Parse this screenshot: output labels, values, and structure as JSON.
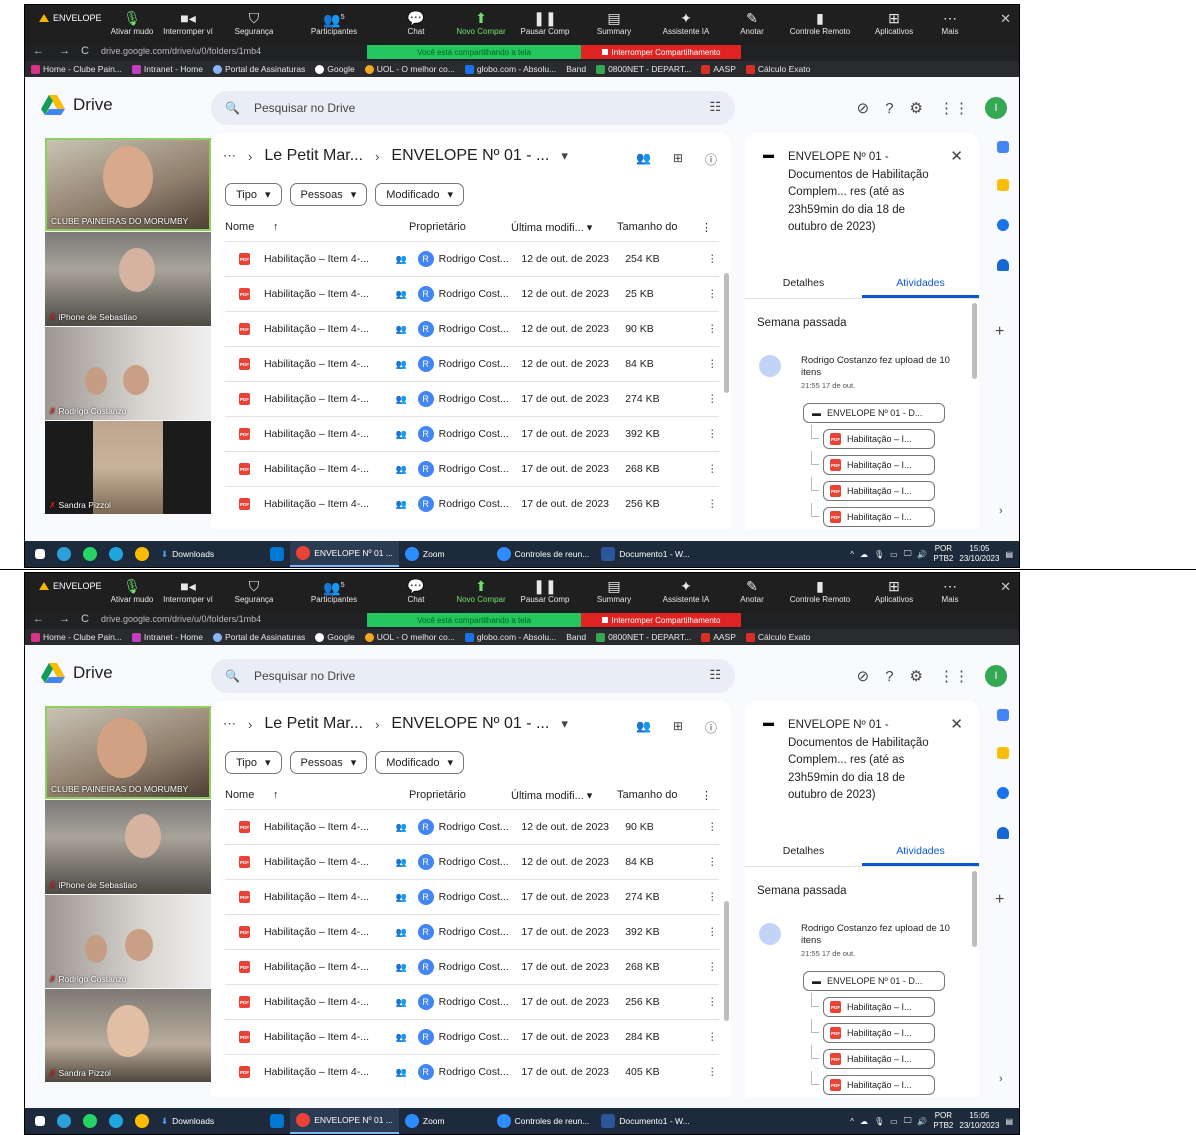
{
  "frames": [
    {
      "zoom": {
        "title": "ENVELOPE",
        "items": [
          {
            "label": "Ativar mudo",
            "icon": "microphone-icon"
          },
          {
            "label": "Interromper ví",
            "icon": "video-camera-icon"
          },
          {
            "label": "Segurança",
            "icon": "shield-icon"
          },
          {
            "label": "Participantes",
            "icon": "participants-icon",
            "count": "5"
          },
          {
            "label": "Chat",
            "icon": "chat-icon"
          },
          {
            "label": "Novo Compar",
            "icon": "share-screen-icon"
          },
          {
            "label": "Pausar Comp",
            "icon": "pause-icon"
          },
          {
            "label": "Summary",
            "icon": "summary-icon"
          },
          {
            "label": "Assistente IA",
            "icon": "sparkle-icon"
          },
          {
            "label": "Anotar",
            "icon": "pen-icon"
          },
          {
            "label": "Controle Remoto",
            "icon": "mouse-icon"
          },
          {
            "label": "Aplicativos",
            "icon": "apps-icon"
          },
          {
            "label": "Mais",
            "icon": "more-icon"
          }
        ],
        "sharing_banner": "Você está compartilhando a tela",
        "stop_sharing": "Interromper Compartilhamento"
      },
      "url": "drive.google.com/drive/u/0/folders/1mb4",
      "bookmarks": [
        "Home - Clube Pain...",
        "Intranet - Home",
        "Portal de Assinaturas",
        "Google",
        "UOL - O melhor co...",
        "globo.com - Absolu...",
        "Band",
        "0800NET - DEPART...",
        "AASP",
        "Cálculo Exato"
      ],
      "drive": {
        "app_name": "Drive",
        "search_placeholder": "Pesquisar no Drive",
        "avatar_letter": "I",
        "breadcrumb_parent": "Le Petit Mar...",
        "breadcrumb_current": "ENVELOPE Nº 01 - ...",
        "filters": [
          "Tipo",
          "Pessoas",
          "Modificado"
        ],
        "columns": {
          "name": "Nome",
          "owner": "Proprietário",
          "modified": "Última modifi...",
          "size": "Tamanho do"
        },
        "files": [
          {
            "name": "Habilitação – Item 4-...",
            "owner": "Rodrigo Cost...",
            "modified": "12 de out. de 2023",
            "size": "254 KB"
          },
          {
            "name": "Habilitação – Item 4-...",
            "owner": "Rodrigo Cost...",
            "modified": "12 de out. de 2023",
            "size": "25 KB"
          },
          {
            "name": "Habilitação – Item 4-...",
            "owner": "Rodrigo Cost...",
            "modified": "12 de out. de 2023",
            "size": "90 KB"
          },
          {
            "name": "Habilitação – Item 4-...",
            "owner": "Rodrigo Cost...",
            "modified": "12 de out. de 2023",
            "size": "84 KB"
          },
          {
            "name": "Habilitação – Item 4-...",
            "owner": "Rodrigo Cost...",
            "modified": "17 de out. de 2023",
            "size": "274 KB"
          },
          {
            "name": "Habilitação – Item 4-...",
            "owner": "Rodrigo Cost...",
            "modified": "17 de out. de 2023",
            "size": "392 KB"
          },
          {
            "name": "Habilitação – Item 4-...",
            "owner": "Rodrigo Cost...",
            "modified": "17 de out. de 2023",
            "size": "268 KB"
          },
          {
            "name": "Habilitação – Item 4-...",
            "owner": "Rodrigo Cost...",
            "modified": "17 de out. de 2023",
            "size": "256 KB"
          }
        ],
        "details": {
          "title": "ENVELOPE Nº 01 - Documentos de Habilitação Complem... res (até as 23h59min do dia 18 de outubro de 2023)",
          "tab_details": "Detalhes",
          "tab_activity": "Atividades",
          "week": "Semana passada",
          "activity_text": "Rodrigo Costanzo fez upload de 10 itens",
          "activity_time": "21:55 17 de out.",
          "folder_chip": "ENVELOPE Nº 01 - D...",
          "file_chips": [
            "Habilitação – I...",
            "Habilitação – I...",
            "Habilitação – I...",
            "Habilitação – I..."
          ]
        }
      },
      "participants": [
        "CLUBE PAINEIRAS DO MORUMBY",
        "iPhone de Sebastiao",
        "Rodrigo Costanzo",
        "Sandra Pizzol"
      ],
      "taskbar": {
        "apps": [
          "Downloads",
          "ENVELOPE Nº 01 ...",
          "Zoom",
          "Controles de reun...",
          "Documento1 - W..."
        ],
        "lang": "POR",
        "kb": "PTB2",
        "time": "15:05",
        "date": "23/10/2023"
      }
    },
    {
      "zoom": {
        "title": "ENVELOPE",
        "items": [
          {
            "label": "Ativar mudo",
            "icon": "microphone-icon"
          },
          {
            "label": "Interromper ví",
            "icon": "video-camera-icon"
          },
          {
            "label": "Segurança",
            "icon": "shield-icon"
          },
          {
            "label": "Participantes",
            "icon": "participants-icon",
            "count": "5"
          },
          {
            "label": "Chat",
            "icon": "chat-icon"
          },
          {
            "label": "Novo Compar",
            "icon": "share-screen-icon"
          },
          {
            "label": "Pausar Comp",
            "icon": "pause-icon"
          },
          {
            "label": "Summary",
            "icon": "summary-icon"
          },
          {
            "label": "Assistente IA",
            "icon": "sparkle-icon"
          },
          {
            "label": "Anotar",
            "icon": "pen-icon"
          },
          {
            "label": "Controle Remoto",
            "icon": "mouse-icon"
          },
          {
            "label": "Aplicativos",
            "icon": "apps-icon"
          },
          {
            "label": "Mais",
            "icon": "more-icon"
          }
        ],
        "sharing_banner": "Você está compartilhando a tela",
        "stop_sharing": "Interromper Compartilhamento"
      },
      "url": "drive.google.com/drive/u/0/folders/1mb4",
      "bookmarks": [
        "Home - Clube Pain...",
        "Intranet - Home",
        "Portal de Assinaturas",
        "Google",
        "UOL - O melhor co...",
        "globo.com - Absolu...",
        "Band",
        "0800NET - DEPART...",
        "AASP",
        "Cálculo Exato"
      ],
      "drive": {
        "app_name": "Drive",
        "search_placeholder": "Pesquisar no Drive",
        "avatar_letter": "I",
        "breadcrumb_parent": "Le Petit Mar...",
        "breadcrumb_current": "ENVELOPE Nº 01 - ...",
        "filters": [
          "Tipo",
          "Pessoas",
          "Modificado"
        ],
        "columns": {
          "name": "Nome",
          "owner": "Proprietário",
          "modified": "Última modifi...",
          "size": "Tamanho do"
        },
        "files": [
          {
            "name": "Habilitação – Item 4-...",
            "owner": "Rodrigo Cost...",
            "modified": "12 de out. de 2023",
            "size": "90 KB"
          },
          {
            "name": "Habilitação – Item 4-...",
            "owner": "Rodrigo Cost...",
            "modified": "12 de out. de 2023",
            "size": "84 KB"
          },
          {
            "name": "Habilitação – Item 4-...",
            "owner": "Rodrigo Cost...",
            "modified": "17 de out. de 2023",
            "size": "274 KB"
          },
          {
            "name": "Habilitação – Item 4-...",
            "owner": "Rodrigo Cost...",
            "modified": "17 de out. de 2023",
            "size": "392 KB"
          },
          {
            "name": "Habilitação – Item 4-...",
            "owner": "Rodrigo Cost...",
            "modified": "17 de out. de 2023",
            "size": "268 KB"
          },
          {
            "name": "Habilitação – Item 4-...",
            "owner": "Rodrigo Cost...",
            "modified": "17 de out. de 2023",
            "size": "256 KB"
          },
          {
            "name": "Habilitação – Item 4-...",
            "owner": "Rodrigo Cost...",
            "modified": "17 de out. de 2023",
            "size": "284 KB"
          },
          {
            "name": "Habilitação – Item 4-...",
            "owner": "Rodrigo Cost...",
            "modified": "17 de out. de 2023",
            "size": "405 KB"
          }
        ],
        "details": {
          "title": "ENVELOPE Nº 01 - Documentos de Habilitação Complem... res (até as 23h59min do dia 18 de outubro de 2023)",
          "tab_details": "Detalhes",
          "tab_activity": "Atividades",
          "week": "Semana passada",
          "activity_text": "Rodrigo Costanzo fez upload de 10 itens",
          "activity_time": "21:55 17 de out.",
          "folder_chip": "ENVELOPE Nº 01 - D...",
          "file_chips": [
            "Habilitação – I...",
            "Habilitação – I...",
            "Habilitação – I...",
            "Habilitação – I..."
          ]
        }
      },
      "participants": [
        "CLUBE PAINEIRAS DO MORUMBY",
        "iPhone de Sebastiao",
        "Rodrigo Costanzo",
        "Sandra Pizzol"
      ],
      "taskbar": {
        "apps": [
          "Downloads",
          "ENVELOPE Nº 01 ...",
          "Zoom",
          "Controles de reun...",
          "Documento1 - W..."
        ],
        "lang": "POR",
        "kb": "PTB2",
        "time": "15:05",
        "date": "23/10/2023"
      }
    }
  ]
}
